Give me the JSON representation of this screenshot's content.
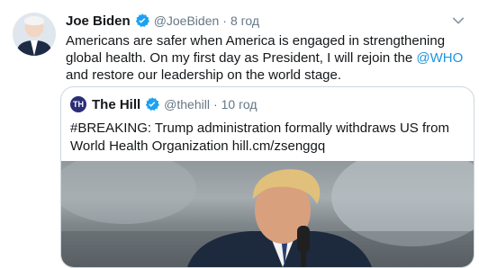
{
  "tweet": {
    "author_name": "Joe Biden",
    "handle": "@JoeBiden",
    "separator": "·",
    "time": "8 год",
    "text_part1": "Americans are safer when America is engaged in strengthening global health. On my first day as President, I will rejoin the ",
    "mention": "@WHO",
    "text_part2": " and restore our leadership on the world stage."
  },
  "quoted_tweet": {
    "logo_text": "TH",
    "author_name": "The Hill",
    "handle": "@thehill",
    "separator": "·",
    "time": "10 год",
    "text": "#BREAKING: Trump administration formally withdraws US from World Health Organization hill.cm/zsenggq"
  },
  "colors": {
    "verified_blue": "#1da1f2",
    "link_blue": "#1b95e0",
    "secondary_text": "#657786",
    "border": "#ccd6dd"
  },
  "icons": [
    "verified-badge-icon",
    "chevron-down-icon"
  ]
}
